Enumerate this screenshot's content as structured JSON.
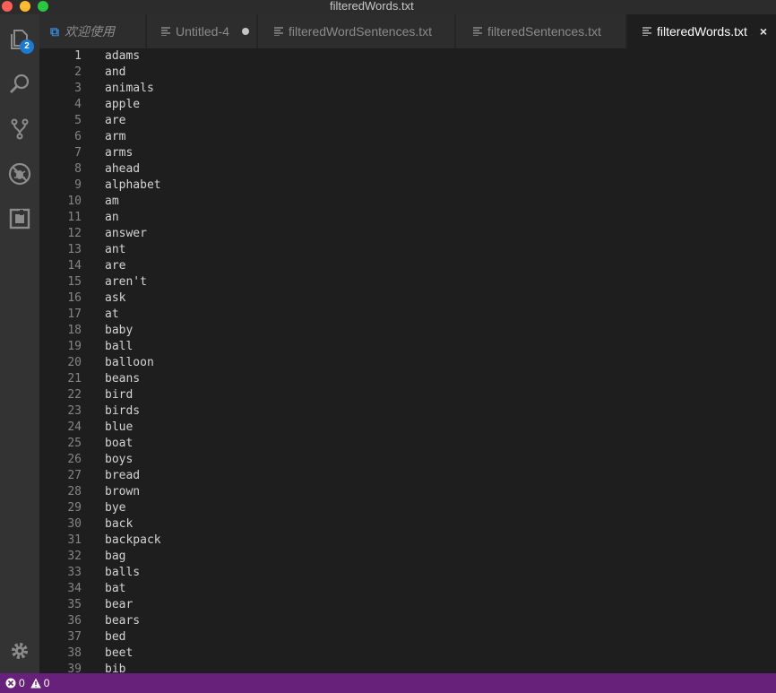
{
  "window": {
    "title": "filteredWords.txt"
  },
  "activity_bar": {
    "items": [
      {
        "icon": "files-icon",
        "badge": "2"
      },
      {
        "icon": "search-icon"
      },
      {
        "icon": "source-control-icon"
      },
      {
        "icon": "debug-icon"
      },
      {
        "icon": "extensions-icon"
      }
    ],
    "bottom_icon": "gear-icon"
  },
  "tabs": [
    {
      "label": "欢迎使用",
      "icon": "vscode-icon",
      "italic": true
    },
    {
      "label": "Untitled-4",
      "icon": "file-icon",
      "dirty": true
    },
    {
      "label": "filteredWordSentences.txt",
      "icon": "file-icon"
    },
    {
      "label": "filteredSentences.txt",
      "icon": "file-icon"
    },
    {
      "label": "filteredWords.txt",
      "icon": "file-icon",
      "active": true,
      "close": "×"
    }
  ],
  "editor": {
    "lines": [
      "adams",
      "and",
      "animals",
      "apple",
      "are",
      "arm",
      "arms",
      "ahead",
      "alphabet",
      "am",
      "an",
      "answer",
      "ant",
      "are",
      "aren't",
      "ask",
      "at",
      "baby",
      "ball",
      "balloon",
      "beans",
      "bird",
      "birds",
      "blue",
      "boat",
      "boys",
      "bread",
      "brown",
      "bye",
      "back",
      "backpack",
      "bag",
      "balls",
      "bat",
      "bear",
      "bears",
      "bed",
      "beet",
      "bib"
    ],
    "active_line": 1
  },
  "status": {
    "errors": "0",
    "warnings": "0"
  },
  "colors": {
    "status_bar": "#68217a",
    "editor_bg": "#1e1e1e",
    "activity_bar": "#333333",
    "badge": "#1a7bd4"
  }
}
